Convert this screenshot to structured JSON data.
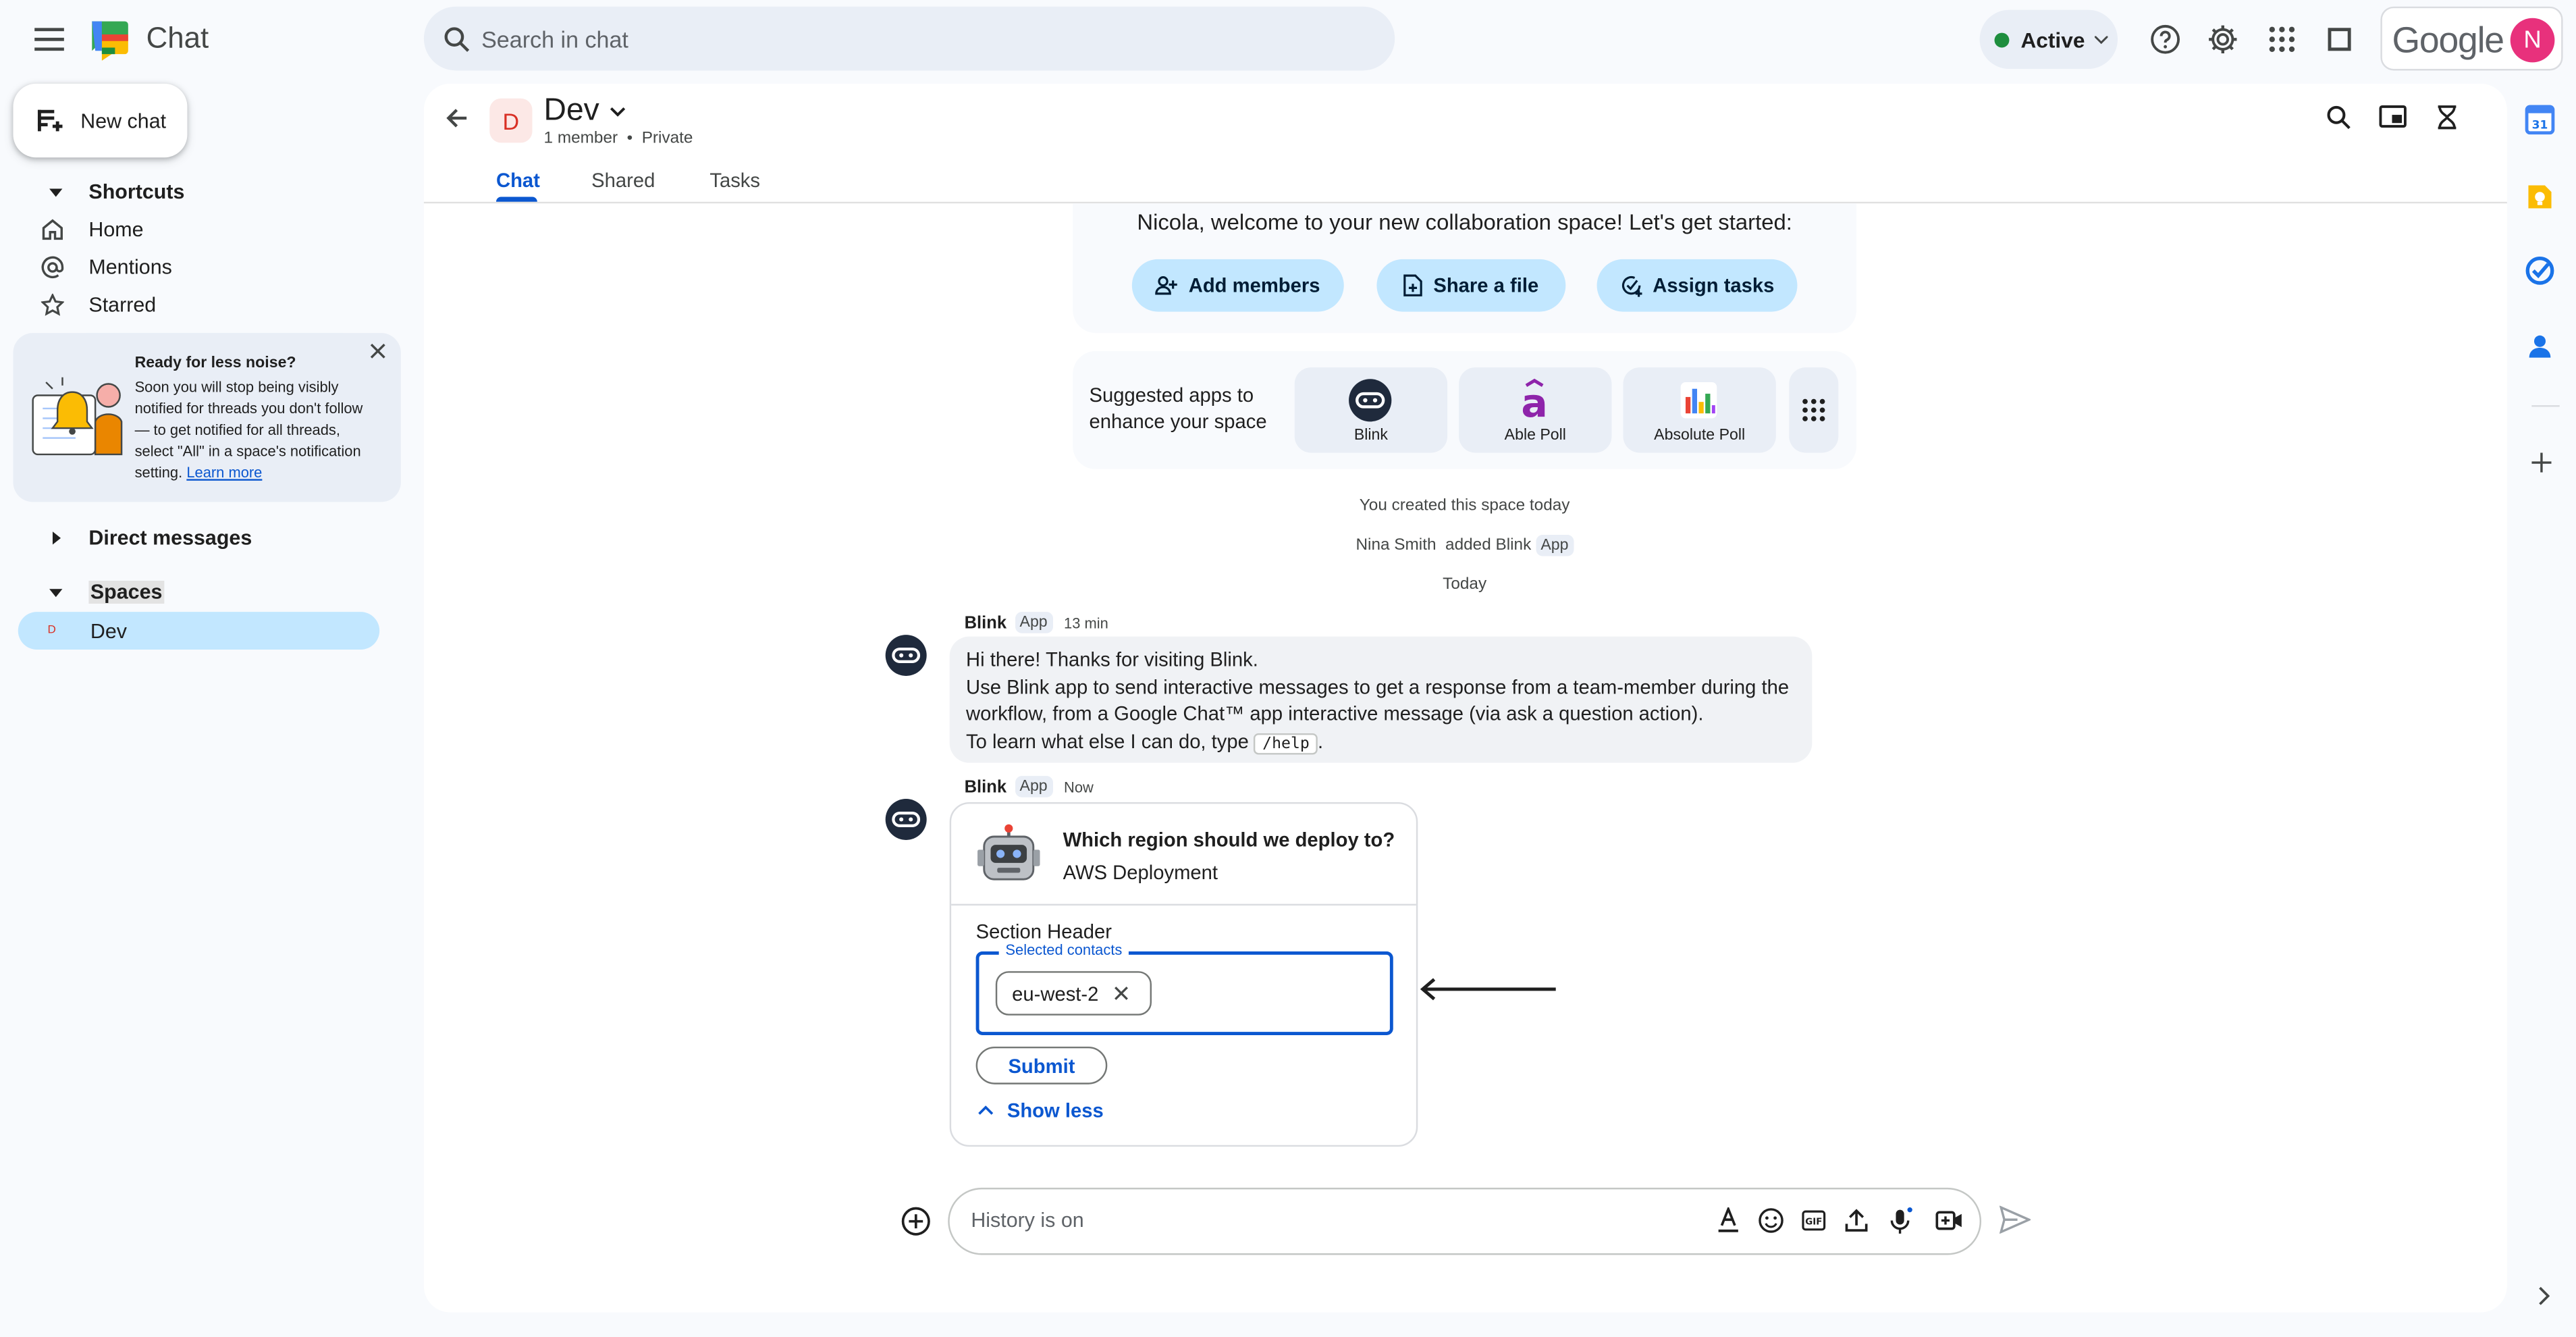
{
  "app": {
    "name": "Chat",
    "logo": "google-chat-logo"
  },
  "search": {
    "placeholder": "Search in chat"
  },
  "status": {
    "label": "Active",
    "color": "#1e8e3e"
  },
  "account": {
    "brand": "Google",
    "avatar_letter": "N",
    "avatar_color": "#e8317c"
  },
  "sidebar": {
    "new_chat": "New chat",
    "shortcuts": {
      "label": "Shortcuts",
      "items": [
        {
          "label": "Home",
          "icon": "home-icon"
        },
        {
          "label": "Mentions",
          "icon": "at-icon"
        },
        {
          "label": "Starred",
          "icon": "star-icon"
        }
      ]
    },
    "notice": {
      "title": "Ready for less noise?",
      "body": "Soon you will stop being visibly notified for threads you don't follow — to get notified for all threads, select \"All\" in a space's notification setting.",
      "link": "Learn more"
    },
    "direct_messages": "Direct messages",
    "spaces": {
      "label": "Spaces",
      "items": [
        {
          "letter": "D",
          "name": "Dev"
        }
      ]
    }
  },
  "space": {
    "letter": "D",
    "name": "Dev",
    "members": "1 member",
    "privacy": "Private",
    "tabs": [
      "Chat",
      "Shared",
      "Tasks"
    ],
    "active_tab": "Chat"
  },
  "welcome": {
    "text": "Nicola, welcome to your new collaboration space! Let's get started:",
    "buttons": [
      "Add members",
      "Share a file",
      "Assign tasks"
    ]
  },
  "suggested_apps": {
    "label": "Suggested apps to enhance your space",
    "apps": [
      "Blink",
      "Able Poll",
      "Absolute Poll"
    ]
  },
  "system": {
    "created": "You created this space today",
    "added_user": "Nina Smith",
    "added_text": "added Blink",
    "app_badge": "App",
    "date_divider": "Today"
  },
  "messages": [
    {
      "sender": "Blink",
      "badge": "App",
      "time": "13 min",
      "lines": [
        "Hi there! Thanks for visiting Blink.",
        "Use Blink app to send interactive messages to get a response from a team-member during the workflow, from a Google Chat™ app interactive message (via ask a question action).",
        "To learn what else I can do, type"
      ],
      "code": "/help",
      "suffix": "."
    },
    {
      "sender": "Blink",
      "badge": "App",
      "time": "Now",
      "card": {
        "question": "Which region should we deploy to?",
        "subtitle": "AWS Deployment",
        "section_header": "Section Header",
        "field_label": "Selected contacts",
        "chip": "eu-west-2",
        "submit": "Submit",
        "show_less": "Show less"
      }
    }
  ],
  "composer": {
    "placeholder": "History is on"
  },
  "colors": {
    "accent": "#0b57d0",
    "selected": "#c2e7ff",
    "surface": "#f8fafd"
  }
}
